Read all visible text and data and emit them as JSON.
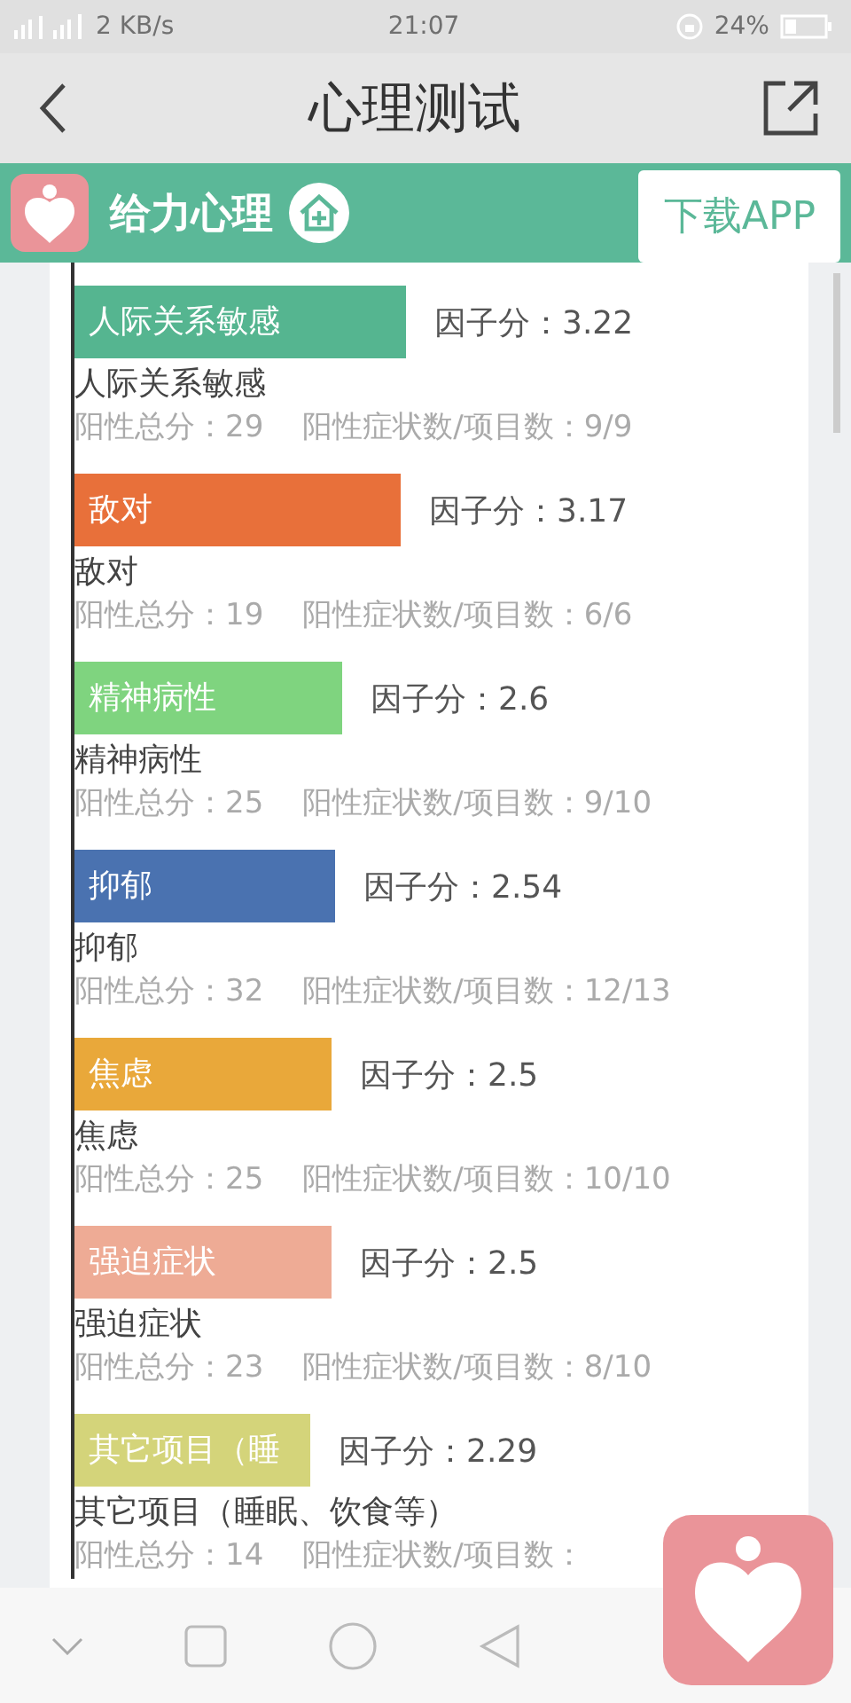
{
  "status_bar": {
    "network_speed": "2 KB/s",
    "time": "21:07",
    "battery": "24%"
  },
  "title_bar": {
    "title": "心理测试"
  },
  "banner": {
    "brand": "给力心理",
    "download_button": "下载APP"
  },
  "factors": [
    {
      "label": "人际关系敏感",
      "color": "#55b590",
      "score": "因子分：3.22",
      "name": "人际关系敏感",
      "positive_total": "阳性总分：29",
      "ratio": "阳性症状数/项目数：9/9"
    },
    {
      "label": "敌对",
      "color": "#e8703a",
      "score": "因子分：3.17",
      "name": "敌对",
      "positive_total": "阳性总分：19",
      "ratio": "阳性症状数/项目数：6/6"
    },
    {
      "label": "精神病性",
      "color": "#7fd47f",
      "score": "因子分：2.6",
      "name": "精神病性",
      "positive_total": "阳性总分：25",
      "ratio": "阳性症状数/项目数：9/10"
    },
    {
      "label": "抑郁",
      "color": "#4a72b0",
      "score": "因子分：2.54",
      "name": "抑郁",
      "positive_total": "阳性总分：32",
      "ratio": "阳性症状数/项目数：12/13"
    },
    {
      "label": "焦虑",
      "color": "#e9a83a",
      "score": "因子分：2.5",
      "name": "焦虑",
      "positive_total": "阳性总分：25",
      "ratio": "阳性症状数/项目数：10/10"
    },
    {
      "label": "强迫症状",
      "color": "#eeab95",
      "score": "因子分：2.5",
      "name": "强迫症状",
      "positive_total": "阳性总分：23",
      "ratio": "阳性症状数/项目数：8/10"
    },
    {
      "label": "其它项目（睡",
      "color": "#d4d47a",
      "score": "因子分：2.29",
      "name": "其它项目（睡眠、饮食等）",
      "positive_total": "阳性总分：14",
      "ratio": "阳性症状数/项目数："
    }
  ]
}
